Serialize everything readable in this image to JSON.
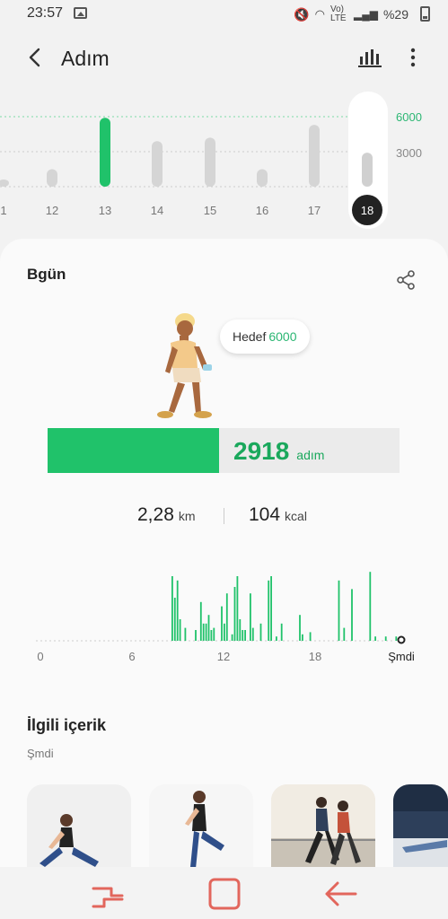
{
  "status_bar": {
    "time": "23:57",
    "network": "Vo) LTE",
    "battery": "%29"
  },
  "header": {
    "title": "Adım"
  },
  "weekly_chart": {
    "goal_label": "6000",
    "mid_label": "3000",
    "days": [
      "1",
      "12",
      "13",
      "14",
      "15",
      "16",
      "17",
      "18"
    ],
    "selected_day": "18",
    "accent": "#20c26a"
  },
  "card": {
    "today_label": "Bgün",
    "goal": {
      "label": "Hedef",
      "value": "6000"
    },
    "steps": {
      "value": "2918",
      "unit": "adım",
      "progress_fraction": 0.486
    },
    "distance": {
      "value": "2,28",
      "unit": "km"
    },
    "calories": {
      "value": "104",
      "unit": "kcal"
    },
    "hourly_axis": [
      "0",
      "6",
      "12",
      "18",
      "Şmdi"
    ],
    "related_title": "İlgili içerik",
    "related_subtitle": "Şmdi"
  },
  "chart_data": [
    {
      "type": "bar",
      "title": "",
      "categories": [
        "1",
        "12",
        "13",
        "14",
        "15",
        "16",
        "17",
        "18"
      ],
      "values": [
        600,
        1500,
        5900,
        3900,
        4200,
        1500,
        5300,
        2918
      ],
      "ylim": [
        0,
        6000
      ],
      "yticks": [
        "3000",
        "6000"
      ]
    },
    {
      "type": "bar",
      "title": "",
      "x_ticks": [
        "0",
        "6",
        "12",
        "18",
        "Şmdi"
      ],
      "values": [
        30,
        20,
        28,
        10,
        0,
        6,
        0,
        0,
        0,
        5,
        0,
        18,
        8,
        8,
        12,
        5,
        6,
        0,
        0,
        16,
        8,
        22,
        0,
        3,
        25,
        30,
        10,
        5,
        5,
        0,
        22,
        6,
        0,
        0,
        8,
        0,
        0,
        28,
        30,
        0,
        2,
        0,
        8,
        0,
        0,
        0,
        0,
        0,
        0,
        12,
        3,
        0,
        0,
        4,
        0,
        0,
        0,
        0,
        0,
        0,
        0,
        0,
        0,
        0,
        28,
        0,
        6,
        0,
        0,
        24,
        0,
        0,
        0,
        0,
        0,
        0,
        32,
        0,
        2,
        0,
        0,
        0,
        2,
        0,
        0,
        0,
        2
      ]
    }
  ]
}
